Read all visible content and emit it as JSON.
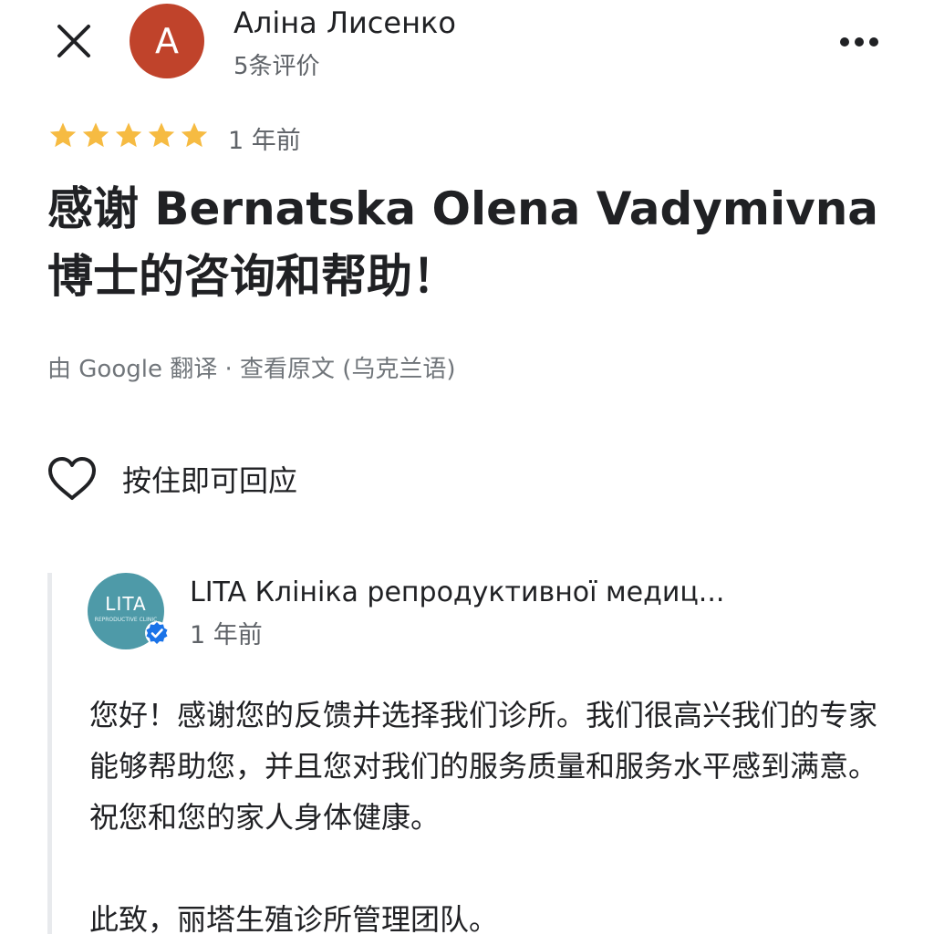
{
  "header": {
    "close_icon": "close-icon",
    "avatar_letter": "A",
    "avatar_color": "#c0432b",
    "author_name": "Аліна Лисенко",
    "review_count": "5条评价",
    "more_icon": "more-horizontal-icon"
  },
  "review": {
    "rating": 5,
    "rating_max": 5,
    "star_color": "#f6bb42",
    "time": "1 年前",
    "text": "感谢 Bernatska Olena Vadymivna 博士的咨询和帮助！",
    "translated_by": "由 Google 翻译",
    "separator": " · ",
    "view_original": "查看原文 (乌克兰语)"
  },
  "like": {
    "icon": "heart-icon",
    "label": "按住即可回应"
  },
  "owner_reply": {
    "logo_text": "LITA",
    "logo_subtext": "REPRODUCTIVE CLINIC",
    "logo_color": "#4e9aa8",
    "verified_icon": "verified-badge-icon",
    "verified_color": "#1a73e8",
    "owner_name": "LITA Клініка репродуктивної медиц...",
    "time": "1 年前",
    "text": "您好！感谢您的反馈并选择我们诊所。我们很高兴我们的专家能够帮助您，并且您对我们的服务质量和服务水平感到满意。祝您和您的家人身体健康。\n\n此致，丽塔生殖诊所管理团队。"
  }
}
